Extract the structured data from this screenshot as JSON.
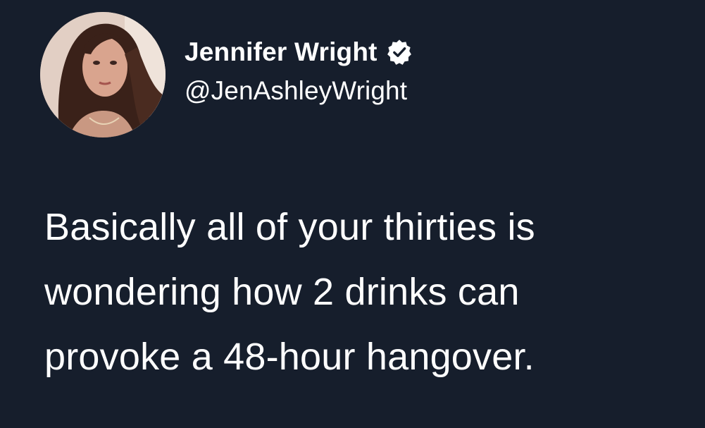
{
  "author": {
    "display_name": "Jennifer Wright",
    "handle": "@JenAshleyWright",
    "verified_icon": "verified-badge-icon",
    "avatar_icon": "profile-photo"
  },
  "tweet": {
    "text": "Basically all of your thirties is\nwondering how 2 drinks can\nprovoke a 48-hour hangover."
  },
  "colors": {
    "background": "#161e2c",
    "text": "#ffffff"
  }
}
